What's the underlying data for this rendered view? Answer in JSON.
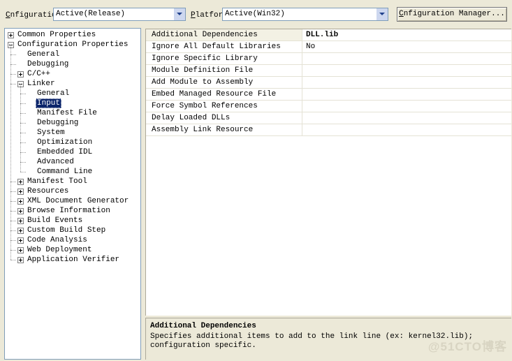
{
  "window": {
    "background_color": "#ece9d8"
  },
  "toolbar": {
    "configuration_label_pre": "C",
    "configuration_label_accel": "o",
    "configuration_label_post": "nfiguration:",
    "configuration_label": "Configuration:",
    "configuration_value": "Active(Release)",
    "platform_label_pre": "",
    "platform_label_accel": "P",
    "platform_label_post": "latform:",
    "platform_label": "Platform:",
    "platform_value": "Active(Win32)",
    "config_manager_pre": "C",
    "config_manager_accel": "o",
    "config_manager_post": "nfiguration Manager...",
    "config_manager_label": "Configuration Manager..."
  },
  "tree": {
    "selected": "Input",
    "nodes": [
      {
        "label": "Common Properties",
        "depth": 0,
        "toggle": "plus",
        "selected": false
      },
      {
        "label": "Configuration Properties",
        "depth": 0,
        "toggle": "minus",
        "selected": false
      },
      {
        "label": "General",
        "depth": 1,
        "toggle": "none",
        "selected": false
      },
      {
        "label": "Debugging",
        "depth": 1,
        "toggle": "none",
        "selected": false
      },
      {
        "label": "C/C++",
        "depth": 1,
        "toggle": "plus",
        "selected": false
      },
      {
        "label": "Linker",
        "depth": 1,
        "toggle": "minus",
        "selected": false
      },
      {
        "label": "General",
        "depth": 2,
        "toggle": "none",
        "selected": false
      },
      {
        "label": "Input",
        "depth": 2,
        "toggle": "none",
        "selected": true
      },
      {
        "label": "Manifest File",
        "depth": 2,
        "toggle": "none",
        "selected": false
      },
      {
        "label": "Debugging",
        "depth": 2,
        "toggle": "none",
        "selected": false
      },
      {
        "label": "System",
        "depth": 2,
        "toggle": "none",
        "selected": false
      },
      {
        "label": "Optimization",
        "depth": 2,
        "toggle": "none",
        "selected": false
      },
      {
        "label": "Embedded IDL",
        "depth": 2,
        "toggle": "none",
        "selected": false
      },
      {
        "label": "Advanced",
        "depth": 2,
        "toggle": "none",
        "selected": false
      },
      {
        "label": "Command Line",
        "depth": 2,
        "toggle": "none",
        "selected": false
      },
      {
        "label": "Manifest Tool",
        "depth": 1,
        "toggle": "plus",
        "selected": false
      },
      {
        "label": "Resources",
        "depth": 1,
        "toggle": "plus",
        "selected": false
      },
      {
        "label": "XML Document Generator",
        "depth": 1,
        "toggle": "plus",
        "selected": false
      },
      {
        "label": "Browse Information",
        "depth": 1,
        "toggle": "plus",
        "selected": false
      },
      {
        "label": "Build Events",
        "depth": 1,
        "toggle": "plus",
        "selected": false
      },
      {
        "label": "Custom Build Step",
        "depth": 1,
        "toggle": "plus",
        "selected": false
      },
      {
        "label": "Code Analysis",
        "depth": 1,
        "toggle": "plus",
        "selected": false
      },
      {
        "label": "Web Deployment",
        "depth": 1,
        "toggle": "plus",
        "selected": false
      },
      {
        "label": "Application Verifier",
        "depth": 1,
        "toggle": "plus",
        "selected": false
      }
    ]
  },
  "grid": {
    "selected_index": 0,
    "rows": [
      {
        "name": "Additional Dependencies",
        "value": "DLL.lib"
      },
      {
        "name": "Ignore All Default Libraries",
        "value": "No"
      },
      {
        "name": "Ignore Specific Library",
        "value": ""
      },
      {
        "name": "Module Definition File",
        "value": ""
      },
      {
        "name": "Add Module to Assembly",
        "value": ""
      },
      {
        "name": "Embed Managed Resource File",
        "value": ""
      },
      {
        "name": "Force Symbol References",
        "value": ""
      },
      {
        "name": "Delay Loaded DLLs",
        "value": ""
      },
      {
        "name": "Assembly Link Resource",
        "value": ""
      }
    ]
  },
  "description": {
    "title": "Additional Dependencies",
    "body": "Specifies additional items to add to the link line (ex: kernel32.lib); configuration specific."
  },
  "watermark": {
    "text": "@51CTO博客"
  }
}
